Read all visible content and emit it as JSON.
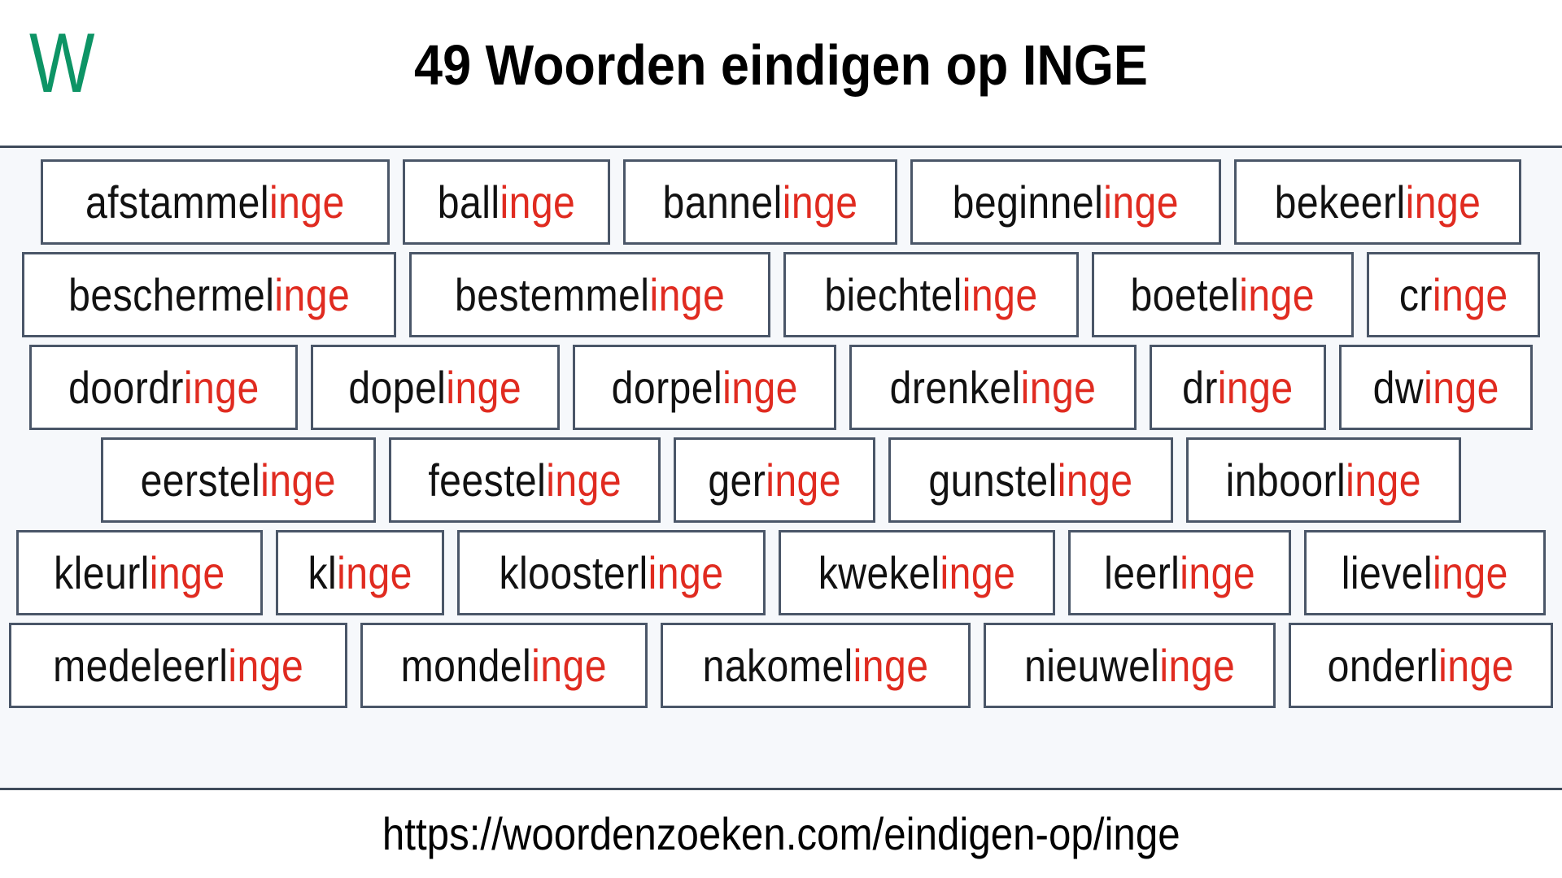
{
  "header": {
    "logo_letter": "W",
    "logo_color": "#0d9465",
    "title": "49 Woorden eindigen op INGE"
  },
  "theme": {
    "suffix_color": "#e02b20",
    "box_border_color": "#4a5668",
    "main_background": "#f6f8fb",
    "text_color": "#111111"
  },
  "main": {
    "highlight_suffix": "inge",
    "word_count": 49,
    "rows": [
      {
        "words": [
          {
            "prefix": "afstammel",
            "suffix": "inge",
            "full": "afstammelinge"
          },
          {
            "prefix": "ball",
            "suffix": "inge",
            "full": "ballinge"
          },
          {
            "prefix": "bannel",
            "suffix": "inge",
            "full": "bannelinge"
          },
          {
            "prefix": "beginnel",
            "suffix": "inge",
            "full": "beginnelinge"
          },
          {
            "prefix": "bekeerl",
            "suffix": "inge",
            "full": "bekeerlinge"
          }
        ]
      },
      {
        "words": [
          {
            "prefix": "beschermel",
            "suffix": "inge",
            "full": "beschermelinge"
          },
          {
            "prefix": "bestemmel",
            "suffix": "inge",
            "full": "bestemmelinge"
          },
          {
            "prefix": "biechtel",
            "suffix": "inge",
            "full": "biechtelinge"
          },
          {
            "prefix": "boetel",
            "suffix": "inge",
            "full": "boetelinge"
          },
          {
            "prefix": "cr",
            "suffix": "inge",
            "full": "cringe"
          }
        ]
      },
      {
        "words": [
          {
            "prefix": "doordr",
            "suffix": "inge",
            "full": "doordringe"
          },
          {
            "prefix": "dopel",
            "suffix": "inge",
            "full": "dopelinge"
          },
          {
            "prefix": "dorpel",
            "suffix": "inge",
            "full": "dorpelinge"
          },
          {
            "prefix": "drenkel",
            "suffix": "inge",
            "full": "drenkelinge"
          },
          {
            "prefix": "dr",
            "suffix": "inge",
            "full": "dringe"
          },
          {
            "prefix": "dw",
            "suffix": "inge",
            "full": "dwinge"
          }
        ]
      },
      {
        "words": [
          {
            "prefix": "eerstel",
            "suffix": "inge",
            "full": "eerstelinge"
          },
          {
            "prefix": "feestel",
            "suffix": "inge",
            "full": "feestelinge"
          },
          {
            "prefix": "ger",
            "suffix": "inge",
            "full": "geringe"
          },
          {
            "prefix": "gunstel",
            "suffix": "inge",
            "full": "gunstelinge"
          },
          {
            "prefix": "inboorl",
            "suffix": "inge",
            "full": "inboorlinge"
          }
        ]
      },
      {
        "words": [
          {
            "prefix": "kleurl",
            "suffix": "inge",
            "full": "kleurlinge"
          },
          {
            "prefix": "kl",
            "suffix": "inge",
            "full": "klinge"
          },
          {
            "prefix": "kloosterl",
            "suffix": "inge",
            "full": "kloosterlinge"
          },
          {
            "prefix": "kwekel",
            "suffix": "inge",
            "full": "kwekelinge"
          },
          {
            "prefix": "leerl",
            "suffix": "inge",
            "full": "leerlinge"
          },
          {
            "prefix": "lievel",
            "suffix": "inge",
            "full": "lievelinge"
          }
        ]
      },
      {
        "words": [
          {
            "prefix": "medeleerl",
            "suffix": "inge",
            "full": "medeleerlinge"
          },
          {
            "prefix": "mondel",
            "suffix": "inge",
            "full": "mondelinge"
          },
          {
            "prefix": "nakomel",
            "suffix": "inge",
            "full": "nakomelinge"
          },
          {
            "prefix": "nieuwel",
            "suffix": "inge",
            "full": "nieuwelinge"
          },
          {
            "prefix": "onderl",
            "suffix": "inge",
            "full": "onderlinge"
          }
        ]
      }
    ]
  },
  "footer": {
    "url": "https://woordenzoeken.com/eindigen-op/inge"
  }
}
